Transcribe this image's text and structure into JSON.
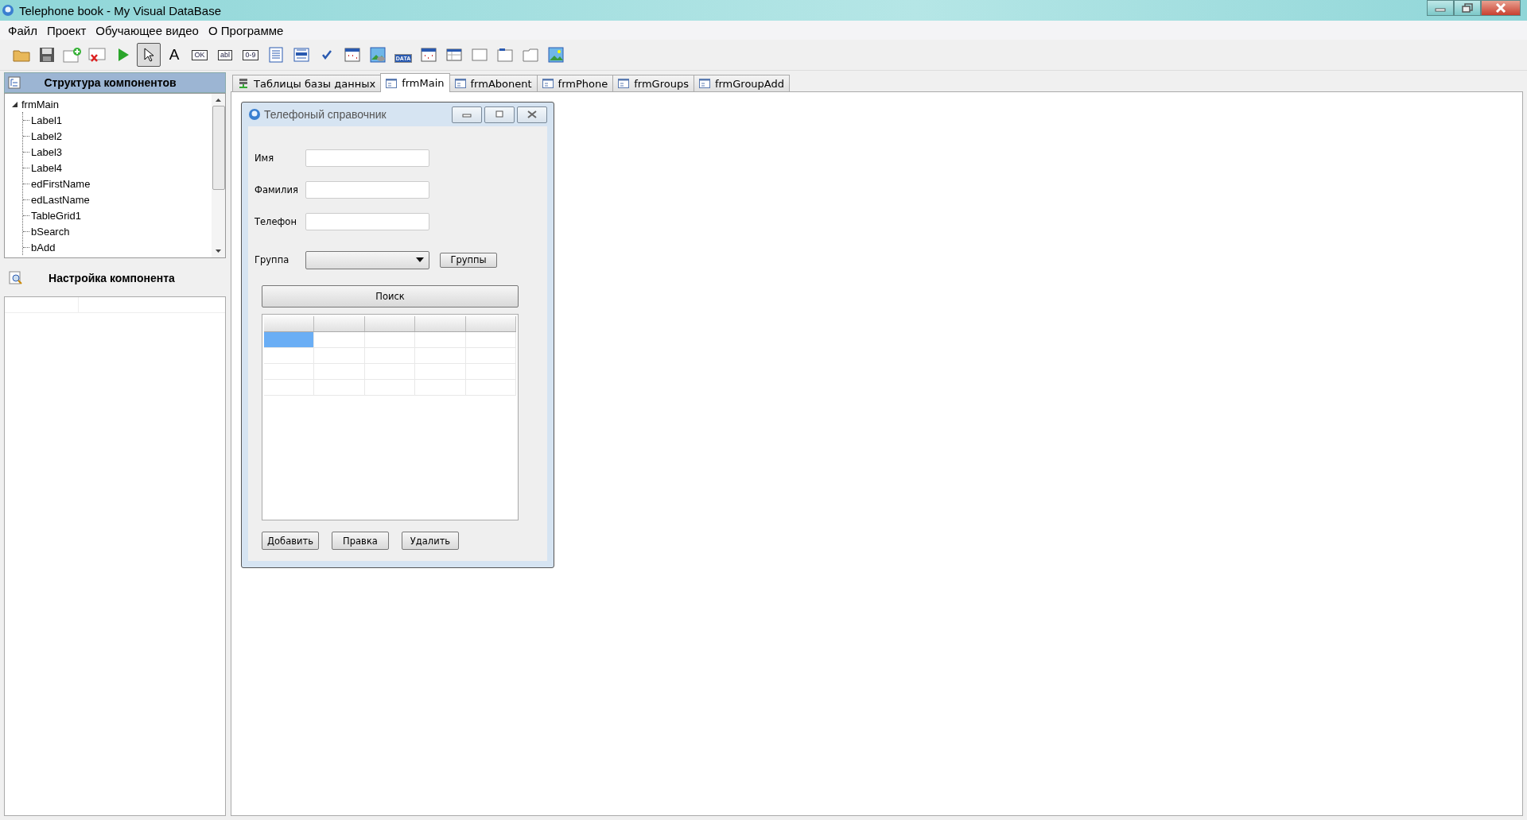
{
  "window": {
    "title": "Telephone book - My Visual DataBase"
  },
  "menu": [
    "Файл",
    "Проект",
    "Обучающее видео",
    "О Программе"
  ],
  "toolbar": [
    {
      "kind": "folder",
      "selected": false
    },
    {
      "kind": "save",
      "selected": false
    },
    {
      "kind": "form-add",
      "selected": false
    },
    {
      "kind": "form-delete",
      "selected": false
    },
    {
      "kind": "run",
      "selected": false
    },
    {
      "kind": "pointer",
      "selected": true
    },
    {
      "kind": "glyph",
      "text": "A",
      "selected": false
    },
    {
      "kind": "chip",
      "text": "OK",
      "selected": false
    },
    {
      "kind": "chip",
      "text": "abl",
      "selected": false
    },
    {
      "kind": "chip",
      "text": "0-9",
      "selected": false
    },
    {
      "kind": "memo",
      "selected": false
    },
    {
      "kind": "list",
      "selected": false
    },
    {
      "kind": "check",
      "selected": false
    },
    {
      "kind": "grid",
      "selected": false
    },
    {
      "kind": "image-db",
      "selected": false
    },
    {
      "kind": "doc",
      "text": "DATA",
      "selected": false
    },
    {
      "kind": "calendar",
      "selected": false
    },
    {
      "kind": "table",
      "selected": false
    },
    {
      "kind": "panel",
      "selected": false
    },
    {
      "kind": "tabpanel",
      "selected": false
    },
    {
      "kind": "groupbox",
      "selected": false
    },
    {
      "kind": "image",
      "selected": false
    }
  ],
  "structure": {
    "title": "Структура компонентов",
    "tree": [
      {
        "label": "frmMain",
        "expanded": true,
        "children": [
          {
            "label": "Label1"
          },
          {
            "label": "Label2"
          },
          {
            "label": "Label3"
          },
          {
            "label": "Label4"
          },
          {
            "label": "edFirstName"
          },
          {
            "label": "edLastName"
          },
          {
            "label": "TableGrid1"
          },
          {
            "label": "bSearch"
          },
          {
            "label": "bAdd"
          }
        ]
      }
    ]
  },
  "properties": {
    "title": "Настройка компонента"
  },
  "tabs": [
    {
      "label": "Таблицы базы данных",
      "kind": "database",
      "selected": false
    },
    {
      "label": "frmMain",
      "kind": "form",
      "selected": true
    },
    {
      "label": "frmAbonent",
      "kind": "form",
      "selected": false
    },
    {
      "label": "frmPhone",
      "kind": "form",
      "selected": false
    },
    {
      "label": "frmGroups",
      "kind": "form",
      "selected": false
    },
    {
      "label": "frmGroupAdd",
      "kind": "form",
      "selected": false
    }
  ],
  "form": {
    "title": "Телефоный справочник",
    "fields": [
      {
        "label": "Имя"
      },
      {
        "label": "Фамилия"
      },
      {
        "label": "Телефон"
      }
    ],
    "group": {
      "label": "Группа",
      "button": "Группы"
    },
    "search_button": "Поиск",
    "grid": {
      "rows": [
        {
          "cells": [
            {
              "selected": true
            },
            {
              "selected": false
            },
            {
              "selected": false
            },
            {
              "selected": false
            },
            {
              "selected": false
            }
          ]
        },
        {
          "cells": [
            {
              "selected": false
            },
            {
              "selected": false
            },
            {
              "selected": false
            },
            {
              "selected": false
            },
            {
              "selected": false
            }
          ]
        },
        {
          "cells": [
            {
              "selected": false
            },
            {
              "selected": false
            },
            {
              "selected": false
            },
            {
              "selected": false
            },
            {
              "selected": false
            }
          ]
        },
        {
          "cells": [
            {
              "selected": false
            },
            {
              "selected": false
            },
            {
              "selected": false
            },
            {
              "selected": false
            },
            {
              "selected": false
            }
          ]
        }
      ]
    },
    "buttons": [
      "Добавить",
      "Правка",
      "Удалить"
    ]
  }
}
